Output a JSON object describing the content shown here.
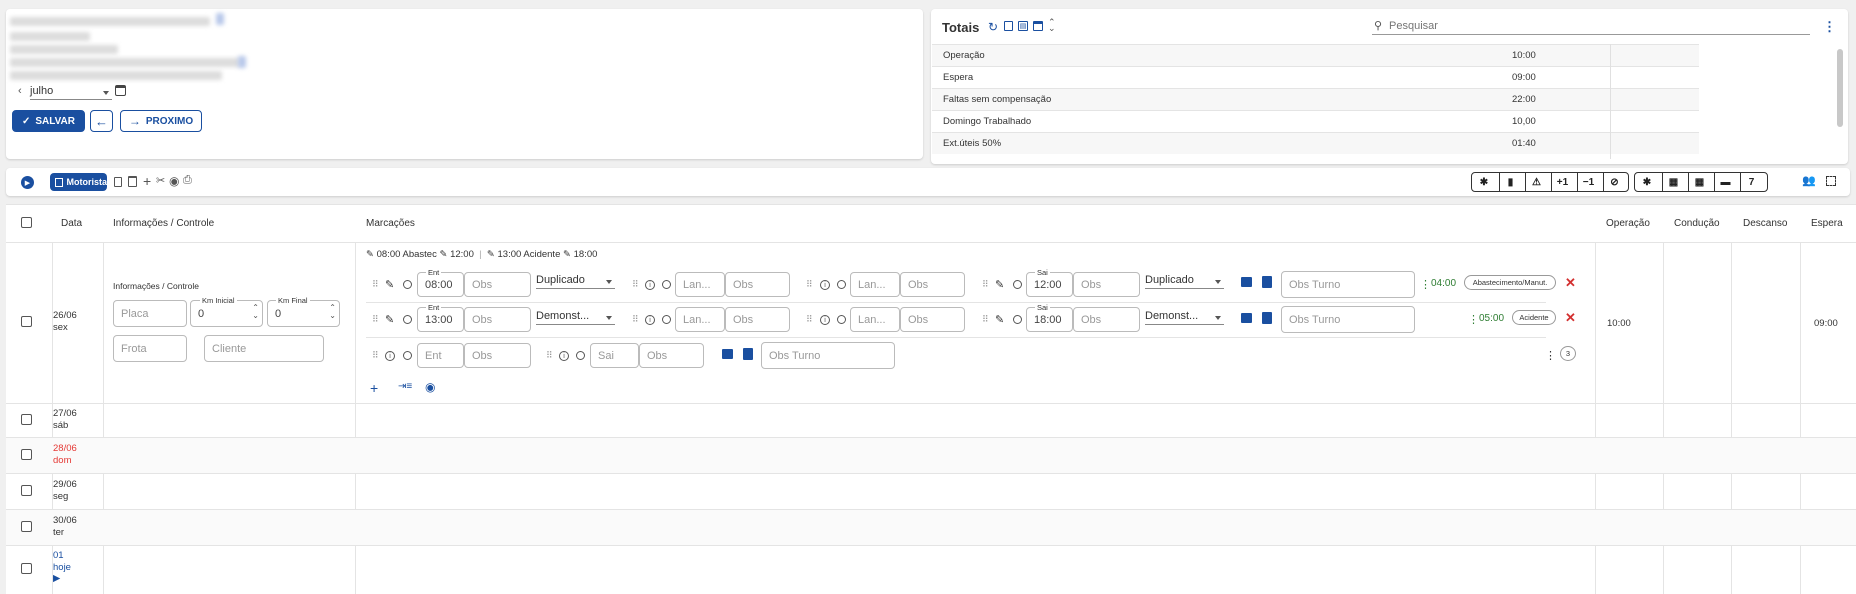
{
  "header": {
    "month": "julho",
    "save_label": "SALVAR",
    "next_label": "PROXIMO"
  },
  "totals": {
    "title": "Totais",
    "search_placeholder": "Pesquisar",
    "rows": [
      {
        "label": "Operação",
        "value": "10:00"
      },
      {
        "label": "Espera",
        "value": "09:00"
      },
      {
        "label": "Faltas sem compensação",
        "value": "22:00"
      },
      {
        "label": "Domingo Trabalhado",
        "value": "10,00"
      },
      {
        "label": "Ext.úteis 50%",
        "value": "01:40"
      }
    ]
  },
  "toolbar": {
    "mode_label": "Motorista",
    "right_buttons": [
      "✱",
      "▮",
      "⚠",
      "+1",
      "−1",
      "⊘"
    ],
    "right_buttons2": [
      "✱",
      "▦",
      "▦",
      "▬",
      "7"
    ]
  },
  "table": {
    "headers": {
      "date": "Data",
      "info": "Informações / Controle",
      "marks": "Marcações",
      "operacao": "Operação",
      "conducao": "Condução",
      "descanso": "Descanso",
      "espera": "Espera"
    },
    "row1": {
      "date": "26/06",
      "weekday": "sex",
      "info_title": "Informações / Controle",
      "placa_placeholder": "Placa",
      "km_inicial_label": "Km Inicial",
      "km_inicial": "0",
      "km_final_label": "Km Final",
      "km_final": "0",
      "frota_placeholder": "Frota",
      "cliente_placeholder": "Cliente",
      "summary_a": "08:00 Abastec",
      "summary_b": "12:00",
      "summary_sep": "|",
      "summary_c": "13:00 Acidente",
      "summary_d": "18:00",
      "ent_label": "Ent",
      "sai_label": "Sai",
      "obs_placeholder": "Obs",
      "lan_placeholder": "Lan...",
      "obs_turno_placeholder": "Obs Turno",
      "ent_placeholder": "Ent",
      "sai_placeholder": "Sai",
      "line1": {
        "ent": "08:00",
        "type": "Duplicado",
        "sai": "12:00",
        "type2": "Duplicado",
        "dur": "04:00",
        "tag": "Abastecimento/Manut."
      },
      "line2": {
        "ent": "13:00",
        "type": "Demonst...",
        "sai": "18:00",
        "type2": "Demonst...",
        "dur": "05:00",
        "tag": "Acidente"
      },
      "count": "3",
      "operacao": "10:00",
      "espera": "09:00"
    },
    "rows": [
      {
        "date": "27/06",
        "weekday": "sáb",
        "color": "#333"
      },
      {
        "date": "28/06",
        "weekday": "dom",
        "color": "#e53935"
      },
      {
        "date": "29/06",
        "weekday": "seg",
        "color": "#333"
      },
      {
        "date": "30/06",
        "weekday": "ter",
        "color": "#333"
      },
      {
        "date": "01",
        "weekday": "hoje",
        "color": "#1a4fa0"
      }
    ]
  }
}
